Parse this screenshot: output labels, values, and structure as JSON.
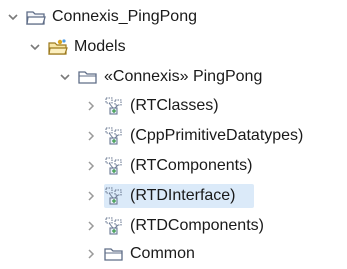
{
  "tree": {
    "root": {
      "label": "Connexis_PingPong",
      "expanded": true
    },
    "models": {
      "label": "Models",
      "expanded": true
    },
    "package": {
      "label": "«Connexis» PingPong",
      "expanded": true
    },
    "children": [
      {
        "label": "(RTClasses)",
        "icon": "model-import-icon",
        "selected": false
      },
      {
        "label": "(CppPrimitiveDatatypes)",
        "icon": "model-import-icon",
        "selected": false
      },
      {
        "label": "(RTComponents)",
        "icon": "model-import-icon",
        "selected": false
      },
      {
        "label": "(RTDInterface)",
        "icon": "model-import-icon",
        "selected": true
      },
      {
        "label": "(RTDComponents)",
        "icon": "model-import-icon",
        "selected": false
      },
      {
        "label": "Common",
        "icon": "folder-icon",
        "selected": false
      }
    ]
  },
  "colors": {
    "selection": "#dbeaf9",
    "chevron": "#7a7a7a",
    "folder": "#5f6d87"
  }
}
